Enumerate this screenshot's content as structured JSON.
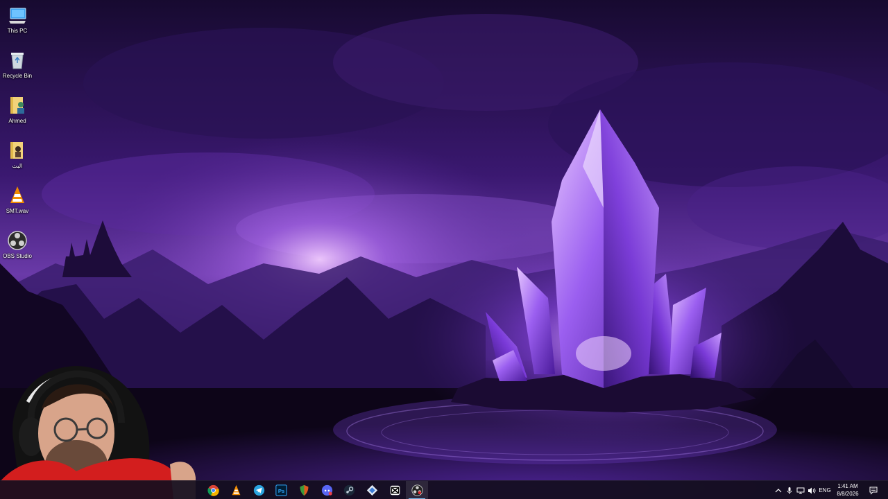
{
  "desktop": {
    "icons": [
      {
        "label": "This PC",
        "icon": "this-pc-icon"
      },
      {
        "label": "Recycle Bin",
        "icon": "recycle-bin-icon"
      },
      {
        "label": "Ahmed",
        "icon": "user-folder-icon"
      },
      {
        "label": "البث",
        "icon": "folder-icon"
      },
      {
        "label": "SMT.wav",
        "icon": "vlc-icon"
      },
      {
        "label": "OBS Studio",
        "icon": "obs-icon"
      }
    ]
  },
  "taskbar": {
    "apps": [
      {
        "name": "chrome-icon"
      },
      {
        "name": "vlc-icon"
      },
      {
        "name": "telegram-icon"
      },
      {
        "name": "photoshop-icon",
        "text": "Ps"
      },
      {
        "name": "shield-browser-icon"
      },
      {
        "name": "discord-icon"
      },
      {
        "name": "steam-icon"
      },
      {
        "name": "diamond-app-icon"
      },
      {
        "name": "capcut-icon"
      },
      {
        "name": "obs-icon"
      }
    ],
    "tray": {
      "language": "ENG",
      "time": "1:41 AM",
      "date": "8/8/2026"
    }
  },
  "colors": {
    "accent": "#76b9ed",
    "sky_top": "#1c0b3a",
    "glow": "#c58cff",
    "crystal": "#9b4dff"
  }
}
